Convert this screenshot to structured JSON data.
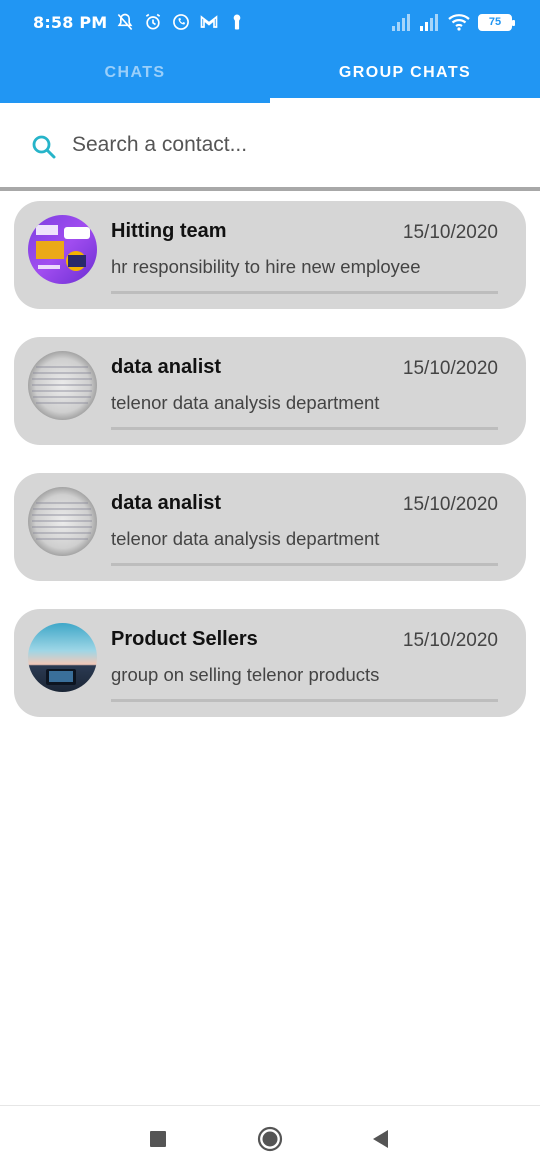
{
  "status_bar": {
    "time": "8:58 PM",
    "battery": "75",
    "left_icons": [
      "bell-off-icon",
      "alarm-icon",
      "whatsapp-icon",
      "gmail-icon",
      "keyhole-icon"
    ],
    "right_icons": [
      "signal-icon",
      "signal-icon",
      "wifi-icon",
      "battery-icon"
    ]
  },
  "tabs": [
    {
      "label": "CHATS",
      "active": false
    },
    {
      "label": "GROUP CHATS",
      "active": true
    }
  ],
  "search": {
    "placeholder": "Search a contact...",
    "value": ""
  },
  "groups": [
    {
      "name": "Hitting team",
      "date": "15/10/2020",
      "description": "hr responsibility to hire new employee"
    },
    {
      "name": "data analist",
      "date": "15/10/2020",
      "description": "telenor data analysis department"
    },
    {
      "name": "data analist",
      "date": "15/10/2020",
      "description": "telenor data analysis department"
    },
    {
      "name": "Product Sellers",
      "date": "15/10/2020",
      "description": "group on selling telenor products"
    }
  ],
  "colors": {
    "primary": "#2196f3",
    "card_bg": "#d6d6d6",
    "search_icon": "#26b4c9"
  },
  "nav_bar": [
    "recents-square-icon",
    "home-circle-icon",
    "back-triangle-icon"
  ]
}
